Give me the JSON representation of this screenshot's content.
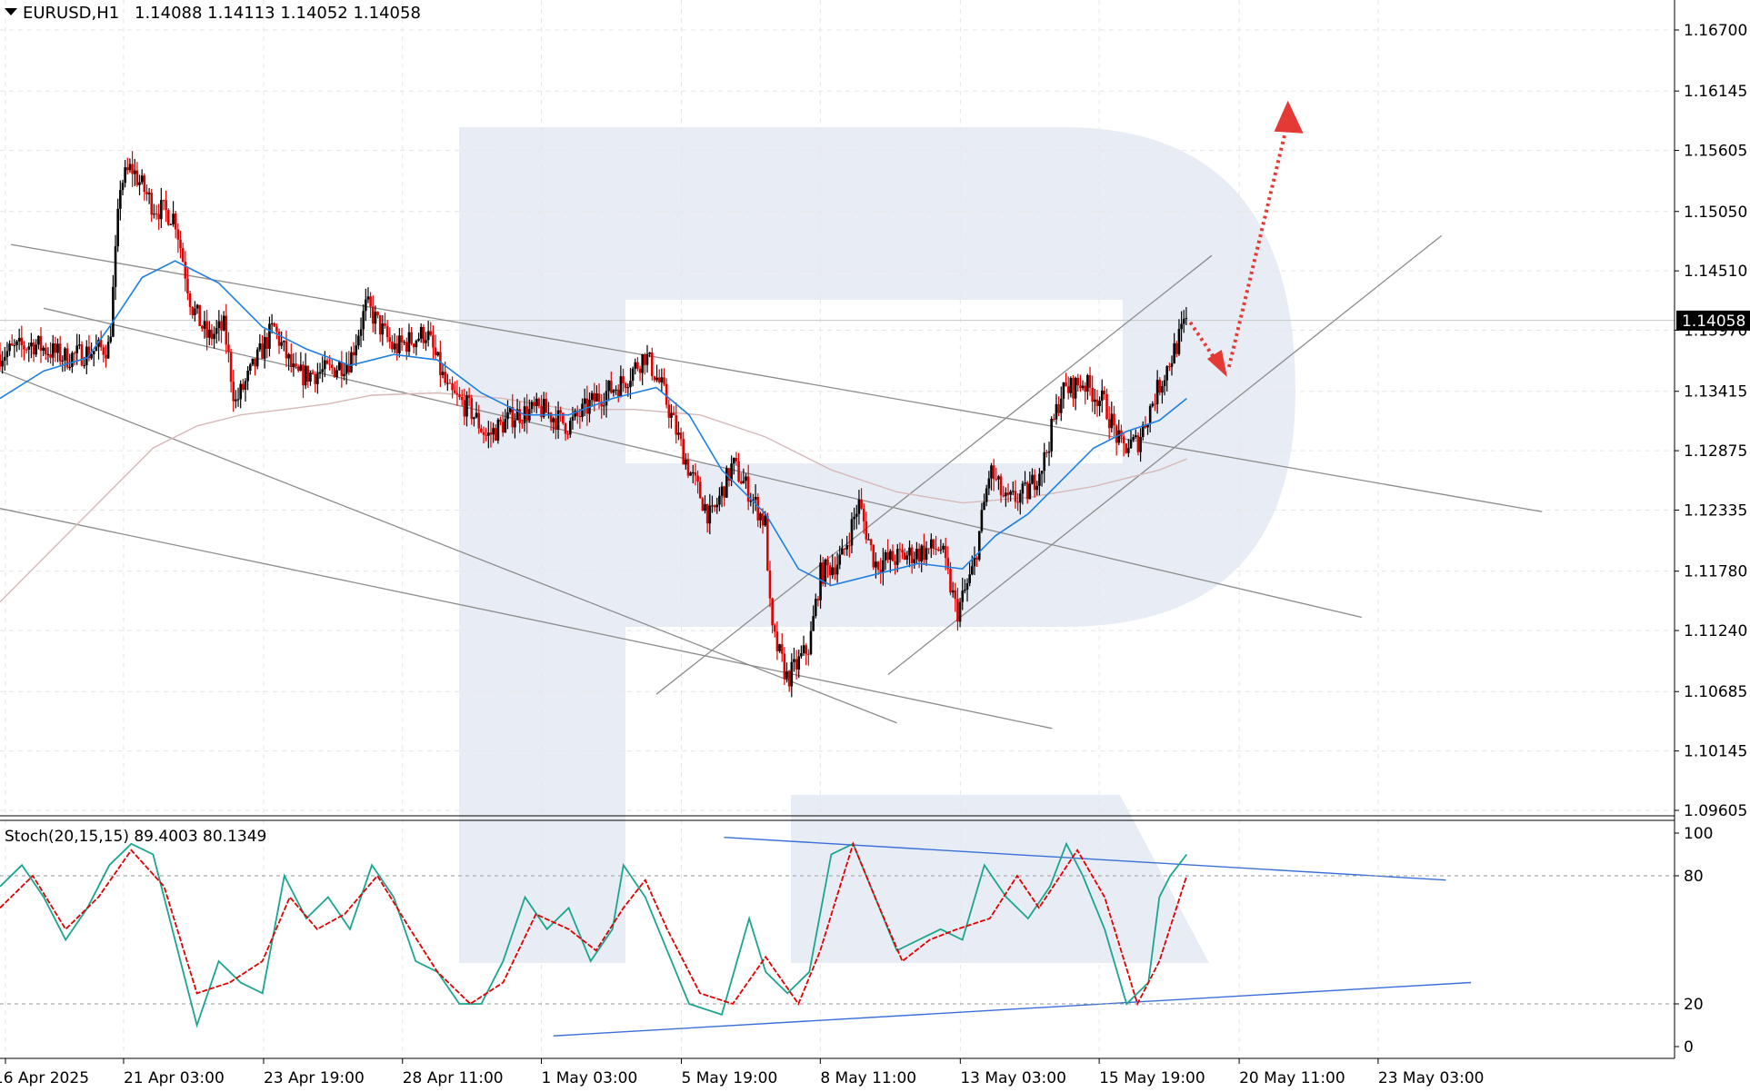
{
  "header": {
    "symbol": "EURUSD,H1",
    "ohlc": "1.14088 1.14113 1.14052 1.14058"
  },
  "stoch_header": "Stoch(20,15,15) 89.4003 80.1349",
  "price_axis": {
    "ticks": [
      "1.16700",
      "1.16145",
      "1.15605",
      "1.15050",
      "1.14510",
      "1.13970",
      "1.13415",
      "1.12875",
      "1.12335",
      "1.11780",
      "1.11240",
      "1.10685",
      "1.10145",
      "1.09605"
    ],
    "current": "1.14058",
    "range": [
      1.09605,
      1.167
    ]
  },
  "stoch_axis": {
    "ticks": [
      "100",
      "80",
      "20",
      "0"
    ],
    "levels": [
      80,
      20
    ]
  },
  "time_axis": {
    "labels": [
      "16 Apr 2025",
      "21 Apr 03:00",
      "23 Apr 19:00",
      "28 Apr 11:00",
      "1 May 03:00",
      "5 May 19:00",
      "8 May 11:00",
      "13 May 03:00",
      "15 May 19:00",
      "20 May 11:00",
      "23 May 03:00"
    ]
  },
  "colors": {
    "bull": "#000000",
    "bear": "#e00000",
    "ma_fast": "#1e7fe0",
    "ma_slow": "#d8b8b8",
    "stoch_main": "#1aa58e",
    "stoch_signal": "#e00000",
    "trendline": "#8c8c8c",
    "stoch_trendline": "#3a6fd8",
    "forecast_arrow": "#e53935",
    "watermark": "#e8edf5"
  },
  "chart_data": {
    "type": "candlestick",
    "symbol": "EURUSD",
    "timeframe": "H1",
    "close_path": [
      [
        0,
        1.1375
      ],
      [
        30,
        1.1385
      ],
      [
        60,
        1.1372
      ],
      [
        100,
        1.1382
      ],
      [
        110,
        1.153
      ],
      [
        120,
        1.1545
      ],
      [
        140,
        1.151
      ],
      [
        160,
        1.15
      ],
      [
        175,
        1.142
      ],
      [
        190,
        1.139
      ],
      [
        205,
        1.14
      ],
      [
        215,
        1.133
      ],
      [
        235,
        1.137
      ],
      [
        250,
        1.14
      ],
      [
        270,
        1.1355
      ],
      [
        300,
        1.136
      ],
      [
        320,
        1.137
      ],
      [
        335,
        1.142
      ],
      [
        360,
        1.138
      ],
      [
        390,
        1.1395
      ],
      [
        410,
        1.134
      ],
      [
        430,
        1.1325
      ],
      [
        445,
        1.13
      ],
      [
        470,
        1.132
      ],
      [
        495,
        1.1325
      ],
      [
        520,
        1.131
      ],
      [
        545,
        1.1335
      ],
      [
        570,
        1.135
      ],
      [
        590,
        1.1375
      ],
      [
        605,
        1.1345
      ],
      [
        630,
        1.127
      ],
      [
        650,
        1.1225
      ],
      [
        670,
        1.1275
      ],
      [
        685,
        1.125
      ],
      [
        700,
        1.122
      ],
      [
        705,
        1.1125
      ],
      [
        720,
        1.108
      ],
      [
        740,
        1.111
      ],
      [
        750,
        1.1175
      ],
      [
        770,
        1.119
      ],
      [
        785,
        1.124
      ],
      [
        800,
        1.1185
      ],
      [
        820,
        1.119
      ],
      [
        840,
        1.1195
      ],
      [
        860,
        1.12
      ],
      [
        875,
        1.114
      ],
      [
        890,
        1.118
      ],
      [
        905,
        1.127
      ],
      [
        920,
        1.124
      ],
      [
        940,
        1.125
      ],
      [
        955,
        1.128
      ],
      [
        970,
        1.134
      ],
      [
        990,
        1.135
      ],
      [
        1010,
        1.133
      ],
      [
        1025,
        1.129
      ],
      [
        1040,
        1.1295
      ],
      [
        1055,
        1.1335
      ],
      [
        1070,
        1.137
      ],
      [
        1085,
        1.1406
      ]
    ],
    "ma_fast": [
      [
        0,
        1.1335
      ],
      [
        40,
        1.136
      ],
      [
        80,
        1.1372
      ],
      [
        100,
        1.14
      ],
      [
        130,
        1.1445
      ],
      [
        160,
        1.146
      ],
      [
        200,
        1.144
      ],
      [
        240,
        1.14
      ],
      [
        280,
        1.138
      ],
      [
        320,
        1.1365
      ],
      [
        360,
        1.1375
      ],
      [
        400,
        1.137
      ],
      [
        440,
        1.134
      ],
      [
        480,
        1.132
      ],
      [
        520,
        1.132
      ],
      [
        560,
        1.1335
      ],
      [
        600,
        1.1345
      ],
      [
        630,
        1.132
      ],
      [
        660,
        1.127
      ],
      [
        700,
        1.123
      ],
      [
        730,
        1.118
      ],
      [
        760,
        1.1165
      ],
      [
        800,
        1.1175
      ],
      [
        840,
        1.1185
      ],
      [
        880,
        1.118
      ],
      [
        910,
        1.121
      ],
      [
        940,
        1.123
      ],
      [
        970,
        1.126
      ],
      [
        1000,
        1.129
      ],
      [
        1030,
        1.1305
      ],
      [
        1060,
        1.1315
      ],
      [
        1085,
        1.1335
      ]
    ],
    "ma_slow": [
      [
        0,
        1.115
      ],
      [
        60,
        1.121
      ],
      [
        100,
        1.125
      ],
      [
        140,
        1.129
      ],
      [
        180,
        1.131
      ],
      [
        220,
        1.132
      ],
      [
        260,
        1.1325
      ],
      [
        300,
        1.133
      ],
      [
        340,
        1.1338
      ],
      [
        400,
        1.134
      ],
      [
        460,
        1.1335
      ],
      [
        520,
        1.1325
      ],
      [
        580,
        1.1325
      ],
      [
        640,
        1.132
      ],
      [
        700,
        1.13
      ],
      [
        760,
        1.127
      ],
      [
        820,
        1.125
      ],
      [
        880,
        1.124
      ],
      [
        940,
        1.1245
      ],
      [
        1000,
        1.1255
      ],
      [
        1060,
        1.127
      ],
      [
        1085,
        1.128
      ]
    ],
    "trendlines": [
      [
        [
          40,
          1.1417
        ],
        [
          1245,
          1.1136
        ]
      ],
      [
        [
          10,
          1.1475
        ],
        [
          1410,
          1.1232
        ]
      ],
      [
        [
          0,
          1.136
        ],
        [
          820,
          1.104
        ]
      ],
      [
        [
          0,
          1.1235
        ],
        [
          962,
          1.1035
        ]
      ],
      [
        [
          600,
          1.1066
        ],
        [
          1108,
          1.1465
        ]
      ],
      [
        [
          812,
          1.1084
        ],
        [
          1318,
          1.1483
        ]
      ]
    ],
    "forecast_path": [
      [
        1085,
        1.14
      ],
      [
        1122,
        1.1357
      ],
      [
        1180,
        1.1605
      ]
    ],
    "stoch_main": [
      [
        0,
        75
      ],
      [
        20,
        85
      ],
      [
        40,
        70
      ],
      [
        60,
        50
      ],
      [
        80,
        65
      ],
      [
        100,
        85
      ],
      [
        120,
        95
      ],
      [
        140,
        90
      ],
      [
        160,
        50
      ],
      [
        180,
        10
      ],
      [
        200,
        40
      ],
      [
        220,
        30
      ],
      [
        240,
        25
      ],
      [
        260,
        80
      ],
      [
        280,
        60
      ],
      [
        300,
        70
      ],
      [
        320,
        55
      ],
      [
        340,
        85
      ],
      [
        360,
        70
      ],
      [
        380,
        40
      ],
      [
        400,
        35
      ],
      [
        420,
        20
      ],
      [
        440,
        20
      ],
      [
        460,
        40
      ],
      [
        480,
        70
      ],
      [
        500,
        55
      ],
      [
        520,
        65
      ],
      [
        540,
        40
      ],
      [
        560,
        55
      ],
      [
        570,
        85
      ],
      [
        590,
        70
      ],
      [
        610,
        45
      ],
      [
        630,
        20
      ],
      [
        660,
        15
      ],
      [
        685,
        60
      ],
      [
        700,
        35
      ],
      [
        720,
        25
      ],
      [
        740,
        35
      ],
      [
        760,
        90
      ],
      [
        780,
        95
      ],
      [
        800,
        70
      ],
      [
        820,
        45
      ],
      [
        840,
        50
      ],
      [
        860,
        55
      ],
      [
        880,
        50
      ],
      [
        900,
        85
      ],
      [
        920,
        70
      ],
      [
        940,
        60
      ],
      [
        960,
        75
      ],
      [
        975,
        95
      ],
      [
        990,
        80
      ],
      [
        1010,
        55
      ],
      [
        1030,
        20
      ],
      [
        1050,
        30
      ],
      [
        1060,
        70
      ],
      [
        1070,
        80
      ],
      [
        1085,
        90
      ]
    ],
    "stoch_signal": [
      [
        0,
        65
      ],
      [
        30,
        80
      ],
      [
        60,
        55
      ],
      [
        90,
        70
      ],
      [
        120,
        92
      ],
      [
        150,
        75
      ],
      [
        180,
        25
      ],
      [
        210,
        30
      ],
      [
        240,
        40
      ],
      [
        265,
        70
      ],
      [
        290,
        55
      ],
      [
        315,
        62
      ],
      [
        345,
        80
      ],
      [
        375,
        55
      ],
      [
        400,
        35
      ],
      [
        430,
        20
      ],
      [
        460,
        30
      ],
      [
        490,
        62
      ],
      [
        520,
        55
      ],
      [
        545,
        45
      ],
      [
        570,
        65
      ],
      [
        590,
        78
      ],
      [
        610,
        55
      ],
      [
        640,
        25
      ],
      [
        670,
        20
      ],
      [
        700,
        42
      ],
      [
        730,
        20
      ],
      [
        750,
        45
      ],
      [
        780,
        95
      ],
      [
        800,
        70
      ],
      [
        825,
        40
      ],
      [
        850,
        50
      ],
      [
        875,
        55
      ],
      [
        905,
        60
      ],
      [
        930,
        80
      ],
      [
        950,
        65
      ],
      [
        985,
        92
      ],
      [
        1010,
        70
      ],
      [
        1040,
        20
      ],
      [
        1060,
        40
      ],
      [
        1085,
        80
      ]
    ],
    "stoch_trendlines": [
      [
        [
          662,
          98
        ],
        [
          1322,
          78
        ]
      ],
      [
        [
          506,
          5
        ],
        [
          1345,
          30
        ]
      ]
    ]
  }
}
